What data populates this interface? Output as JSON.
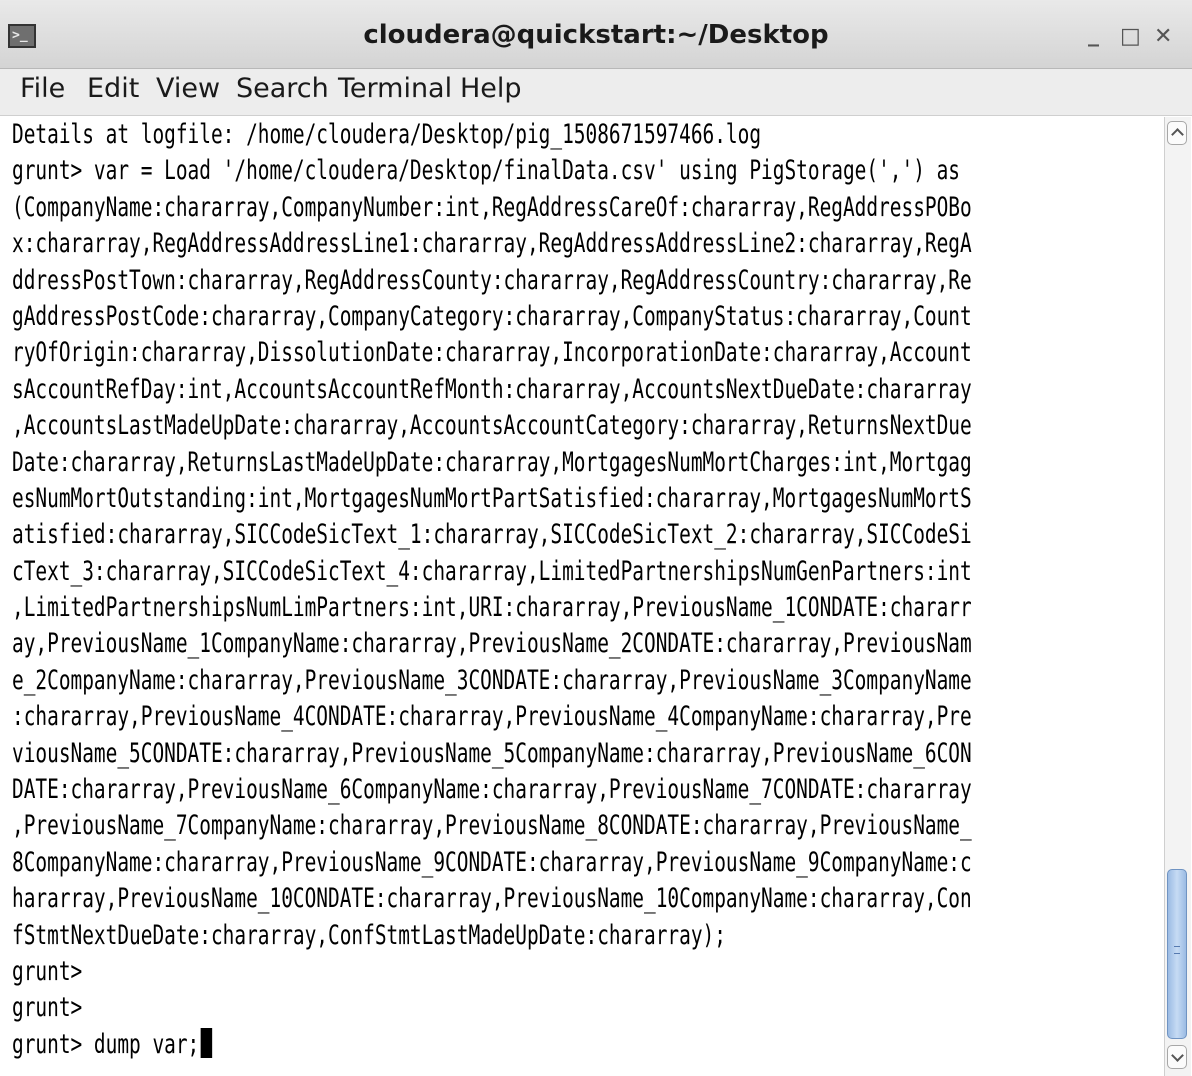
{
  "window": {
    "title": "cloudera@quickstart:~/Desktop",
    "icon": "terminal-icon",
    "controls": {
      "minimize": "_",
      "maximize": "□",
      "close": "✕"
    }
  },
  "menubar": {
    "items": [
      "File",
      "Edit",
      "View",
      "Search",
      "Terminal",
      "Help"
    ]
  },
  "terminal": {
    "lines": [
      "Details at logfile: /home/cloudera/Desktop/pig_1508671597466.log",
      "grunt> var = Load '/home/cloudera/Desktop/finalData.csv' using PigStorage(',') as",
      "(CompanyName:chararray,CompanyNumber:int,RegAddressCareOf:chararray,RegAddressPOBo",
      "x:chararray,RegAddressAddressLine1:chararray,RegAddressAddressLine2:chararray,RegA",
      "ddressPostTown:chararray,RegAddressCounty:chararray,RegAddressCountry:chararray,Re",
      "gAddressPostCode:chararray,CompanyCategory:chararray,CompanyStatus:chararray,Count",
      "ryOfOrigin:chararray,DissolutionDate:chararray,IncorporationDate:chararray,Account",
      "sAccountRefDay:int,AccountsAccountRefMonth:chararray,AccountsNextDueDate:chararray",
      ",AccountsLastMadeUpDate:chararray,AccountsAccountCategory:chararray,ReturnsNextDue",
      "Date:chararray,ReturnsLastMadeUpDate:chararray,MortgagesNumMortCharges:int,Mortgag",
      "esNumMortOutstanding:int,MortgagesNumMortPartSatisfied:chararray,MortgagesNumMortS",
      "atisfied:chararray,SICCodeSicText_1:chararray,SICCodeSicText_2:chararray,SICCodeSi",
      "cText_3:chararray,SICCodeSicText_4:chararray,LimitedPartnershipsNumGenPartners:int",
      ",LimitedPartnershipsNumLimPartners:int,URI:chararray,PreviousName_1CONDATE:chararr",
      "ay,PreviousName_1CompanyName:chararray,PreviousName_2CONDATE:chararray,PreviousNam",
      "e_2CompanyName:chararray,PreviousName_3CONDATE:chararray,PreviousName_3CompanyName",
      ":chararray,PreviousName_4CONDATE:chararray,PreviousName_4CompanyName:chararray,Pre",
      "viousName_5CONDATE:chararray,PreviousName_5CompanyName:chararray,PreviousName_6CON",
      "DATE:chararray,PreviousName_6CompanyName:chararray,PreviousName_7CONDATE:chararray",
      ",PreviousName_7CompanyName:chararray,PreviousName_8CONDATE:chararray,PreviousName_",
      "8CompanyName:chararray,PreviousName_9CONDATE:chararray,PreviousName_9CompanyName:c",
      "hararray,PreviousName_10CONDATE:chararray,PreviousName_10CompanyName:chararray,Con",
      "fStmtNextDueDate:chararray,ConfStmtLastMadeUpDate:chararray);",
      "grunt>",
      "grunt>",
      "grunt> dump var;"
    ]
  },
  "scrollbar": {
    "position_fraction": 0.85,
    "grip_icon": "grip-lines-icon",
    "up_icon": "chevron-up-icon",
    "down_icon": "chevron-down-icon"
  }
}
